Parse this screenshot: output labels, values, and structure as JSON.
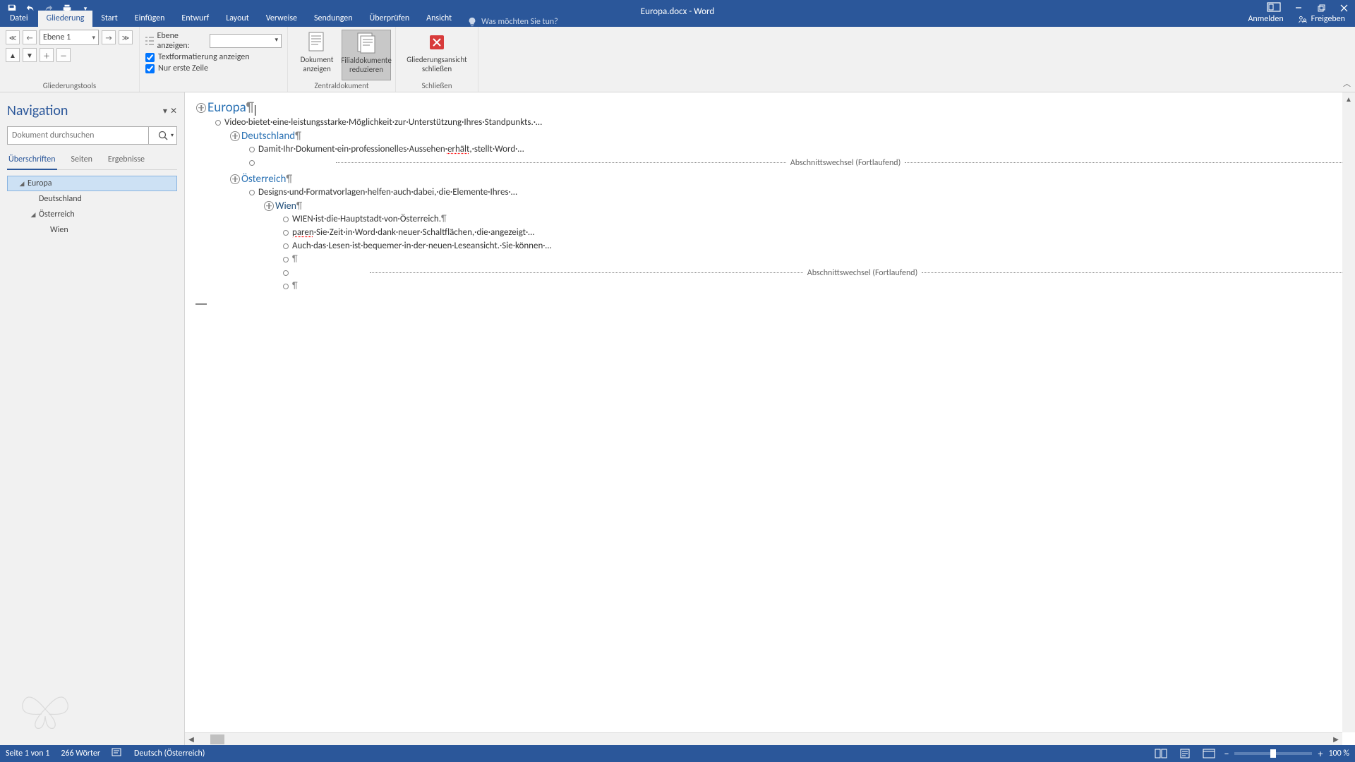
{
  "title": "Europa.docx - Word",
  "right_account": "Anmelden",
  "share_label": "Freigeben",
  "tabs": {
    "file": "Datei",
    "outline": "Gliederung",
    "start": "Start",
    "insert": "Einfügen",
    "draw": "Entwurf",
    "layout": "Layout",
    "references": "Verweise",
    "mailings": "Sendungen",
    "review": "Überprüfen",
    "view": "Ansicht"
  },
  "tell_me_placeholder": "Was möchten Sie tun?",
  "ribbon": {
    "level_value": "Ebene 1",
    "show_level_label": "Ebene anzeigen:",
    "show_text_formatting": "Textformatierung anzeigen",
    "only_first_line": "Nur erste Zeile",
    "outlining_tools": "Gliederungstools",
    "show_doc": "Dokument anzeigen",
    "collapse_subdocs": "Filialdokumente reduzieren",
    "master_doc": "Zentraldokument",
    "close_outline": "Gliederungsansicht schließen",
    "close_group": "Schließen"
  },
  "nav": {
    "title": "Navigation",
    "search_placeholder": "Dokument durchsuchen",
    "tab_headings": "Überschriften",
    "tab_pages": "Seiten",
    "tab_results": "Ergebnisse",
    "tree": {
      "europa": "Europa",
      "deutschland": "Deutschland",
      "oesterreich": "Österreich",
      "wien": "Wien"
    }
  },
  "outline": {
    "h1_europa": "Europa",
    "body1": "Video·bietet·eine·leistungsstarke·Möglichkeit·zur·Unterstützung·Ihres·Standpunkts.·…",
    "h2_deutschland": "Deutschland",
    "body2a": "Damit·Ihr·Dokument·ein·professionelles·Aussehen·",
    "body2_err": "erhält",
    "body2b": ",·stellt·Word·…",
    "section_break": "Abschnittswechsel (Fortlaufend)",
    "h2_oesterreich": "Österreich",
    "body3": "Designs·und·Formatvorlagen·helfen·auch·dabei,·die·Elemente·Ihres·…",
    "h3_wien": "Wien",
    "body4": "WIEN·ist·die·Hauptstadt·von·Österreich.",
    "body5a_err": "paren",
    "body5b": "·Sie·Zeit·in·Word·dank·neuer·Schaltflächen,·die·angezeigt·…",
    "body6": "Auch·das·Lesen·ist·bequemer·in·der·neuen·Leseansicht.·Sie·können·…",
    "pilcrow": "¶"
  },
  "status": {
    "page": "Seite 1 von 1",
    "words": "266 Wörter",
    "language": "Deutsch (Österreich)",
    "zoom": "100 %"
  }
}
